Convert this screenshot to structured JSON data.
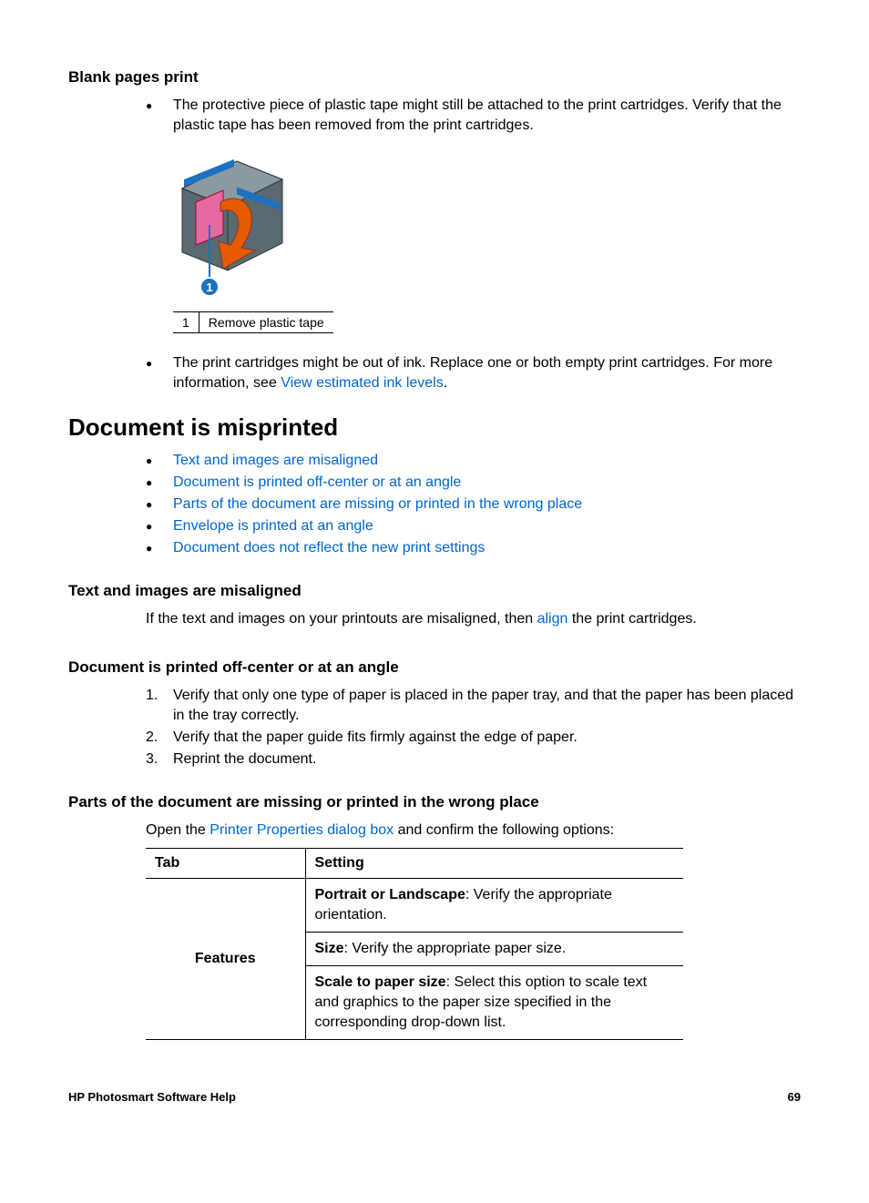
{
  "s1": {
    "title": "Blank pages print",
    "bullet1": "The protective piece of plastic tape might still be attached to the print cartridges. Verify that the plastic tape has been removed from the print cartridges.",
    "caption_num": "1",
    "caption_text": "Remove plastic tape",
    "bullet2_a": "The print cartridges might be out of ink. Replace one or both empty print cartridges. For more information, see ",
    "bullet2_link": "View estimated ink levels",
    "bullet2_c": "."
  },
  "s2": {
    "title": "Document is misprinted",
    "items": [
      "Text and images are misaligned",
      "Document is printed off-center or at an angle",
      "Parts of the document are missing or printed in the wrong place",
      "Envelope is printed at an angle",
      "Document does not reflect the new print settings"
    ]
  },
  "s3": {
    "title": "Text and images are misaligned",
    "text_a": "If the text and images on your printouts are misaligned, then ",
    "link": "align",
    "text_b": " the print cartridges."
  },
  "s4": {
    "title": "Document is printed off-center or at an angle",
    "steps": [
      "Verify that only one type of paper is placed in the paper tray, and that the paper has been placed in the tray correctly.",
      "Verify that the paper guide fits firmly against the edge of paper.",
      "Reprint the document."
    ]
  },
  "s5": {
    "title": "Parts of the document are missing or printed in the wrong place",
    "intro_a": "Open the ",
    "intro_link": "Printer Properties dialog box",
    "intro_b": " and confirm the following options:",
    "col1": "Tab",
    "col2": "Setting",
    "tab_label": "Features",
    "row1_bold": "Portrait or Landscape",
    "row1_rest": ": Verify the appropriate orientation.",
    "row2_bold": "Size",
    "row2_rest": ": Verify the appropriate paper size.",
    "row3_bold": "Scale to paper size",
    "row3_rest": ": Select this option to scale text and graphics to the paper size specified in the corresponding drop-down list."
  },
  "footer": {
    "left": "HP Photosmart Software Help",
    "right": "69"
  }
}
